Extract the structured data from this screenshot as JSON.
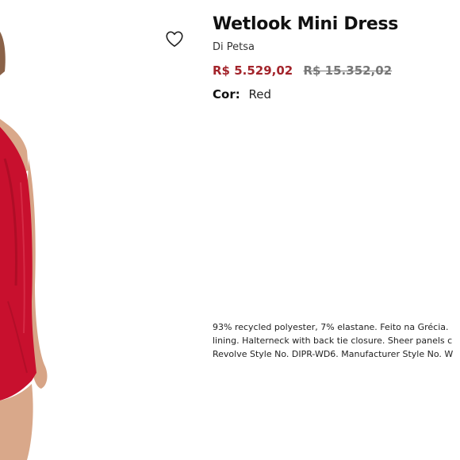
{
  "product": {
    "title": "Wetlook Mini Dress",
    "brand": "Di Petsa",
    "price_sale": "R$ 5.529,02",
    "price_original": "R$ 15.352,02",
    "color_label": "Cor:",
    "color_value": "Red",
    "description_lines": [
      "93% recycled polyester, 7% elastane. Feito na Grécia.",
      "lining. Halterneck with back tie closure. Sheer panels c",
      "Revolve Style No. DIPR-WD6. Manufacturer Style No. W"
    ]
  },
  "image": {
    "alt": "Model wearing red wetlook mini dress",
    "dress_color": "#c8102e",
    "skin_color": "#d9a88a"
  },
  "icons": {
    "wishlist": "heart-outline-icon"
  },
  "colors": {
    "sale_price": "#a3242b",
    "original_price": "#777777"
  }
}
